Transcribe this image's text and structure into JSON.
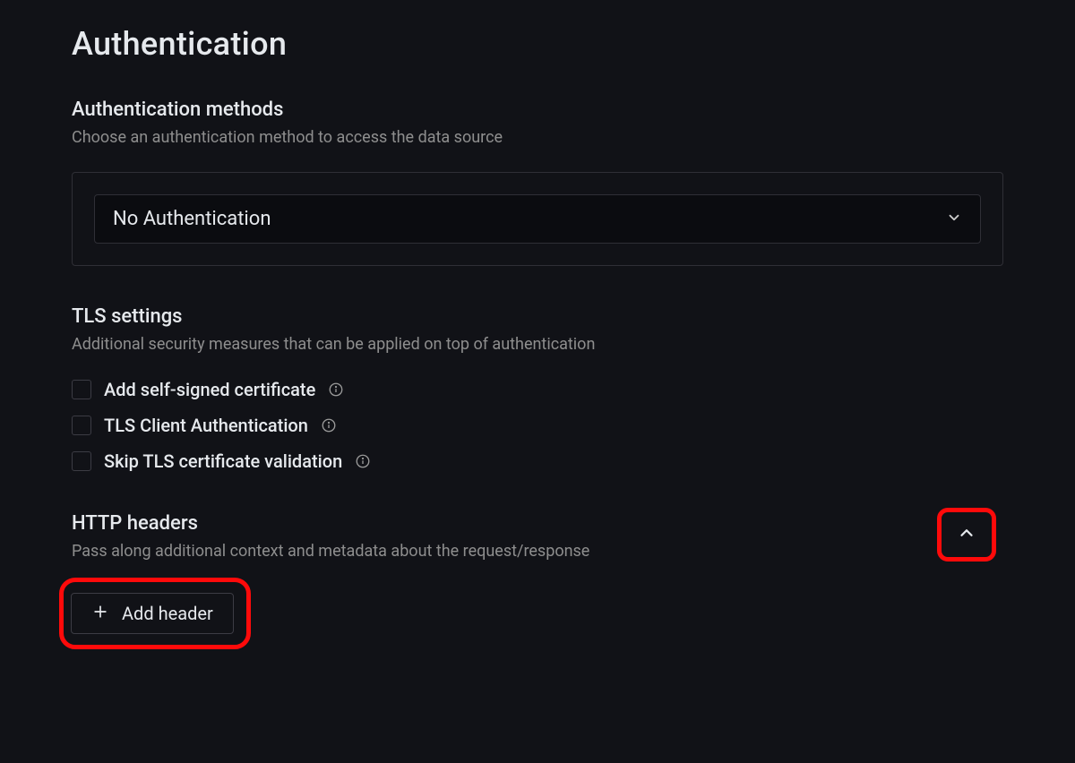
{
  "page": {
    "title": "Authentication"
  },
  "auth_methods": {
    "title": "Authentication methods",
    "description": "Choose an authentication method to access the data source",
    "selected": "No Authentication"
  },
  "tls": {
    "title": "TLS settings",
    "description": "Additional security measures that can be applied on top of authentication",
    "options": [
      {
        "label": "Add self-signed certificate",
        "checked": false
      },
      {
        "label": "TLS Client Authentication",
        "checked": false
      },
      {
        "label": "Skip TLS certificate validation",
        "checked": false
      }
    ]
  },
  "http_headers": {
    "title": "HTTP headers",
    "description": "Pass along additional context and metadata about the request/response",
    "add_button_label": "Add header"
  }
}
